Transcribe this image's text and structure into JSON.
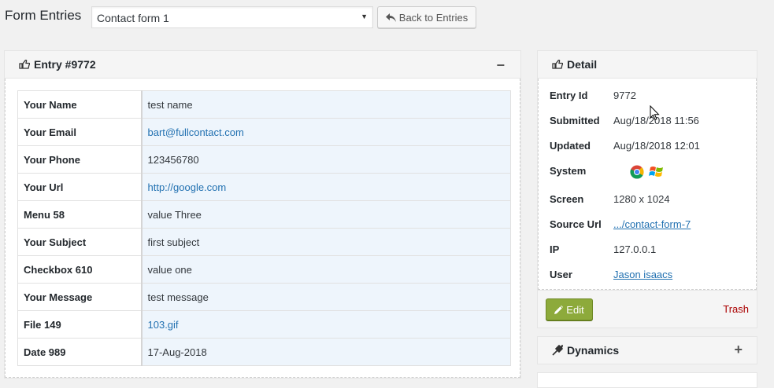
{
  "header": {
    "title": "Form Entries",
    "form_select": {
      "selected": "Contact form 1"
    },
    "back_button": "Back to Entries"
  },
  "entry": {
    "title": "Entry #9772",
    "fields": [
      {
        "label": "Your Name",
        "value": "test name",
        "is_link": false
      },
      {
        "label": "Your Email",
        "value": "bart@fullcontact.com",
        "is_link": true
      },
      {
        "label": "Your Phone",
        "value": "123456780",
        "is_link": false
      },
      {
        "label": "Your Url",
        "value": "http://google.com",
        "is_link": true
      },
      {
        "label": "Menu 58",
        "value": "value Three",
        "is_link": false
      },
      {
        "label": "Your Subject",
        "value": "first subject",
        "is_link": false
      },
      {
        "label": "Checkbox 610",
        "value": "value one",
        "is_link": false
      },
      {
        "label": "Your Message",
        "value": "test message",
        "is_link": false
      },
      {
        "label": "File 149",
        "value": "103.gif",
        "is_link": true
      },
      {
        "label": "Date 989",
        "value": "17-Aug-2018",
        "is_link": false
      }
    ]
  },
  "detail": {
    "title": "Detail",
    "rows": [
      {
        "key": "Entry Id",
        "value": "9772"
      },
      {
        "key": "Submitted",
        "value": "Aug/18/2018 11:56"
      },
      {
        "key": "Updated",
        "value": "Aug/18/2018 12:01"
      },
      {
        "key": "System",
        "value": ""
      },
      {
        "key": "Screen",
        "value": "1280 x 1024"
      },
      {
        "key": "Source Url",
        "value": ".../contact-form-7"
      },
      {
        "key": "IP",
        "value": "127.0.0.1"
      },
      {
        "key": "User",
        "value": "Jason isaacs"
      }
    ],
    "system_icons": [
      "chrome-browser-icon",
      "windows-os-icon"
    ],
    "edit_button": "Edit",
    "trash_link": "Trash"
  },
  "dynamics": {
    "title": "Dynamics"
  },
  "colors": {
    "accent_link": "#2271b1",
    "edit_green": "#8daa3b",
    "trash_red": "#a00000",
    "value_cell_bg": "#eef5fc"
  }
}
